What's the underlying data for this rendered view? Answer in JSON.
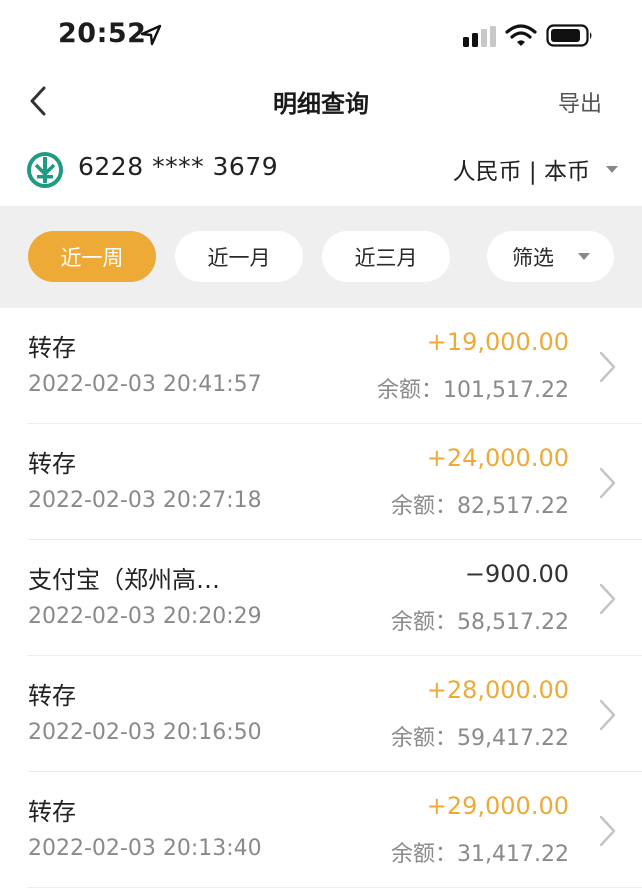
{
  "status_bar": {
    "time": "20:52"
  },
  "nav": {
    "title": "明细查询",
    "export_label": "导出"
  },
  "account": {
    "card_number": "6228 **** 3679",
    "currency": "人民币 | 本币"
  },
  "filters": [
    {
      "label": "近一周",
      "active": true
    },
    {
      "label": "近一月",
      "active": false
    },
    {
      "label": "近三月",
      "active": false
    },
    {
      "label": "筛选",
      "active": false
    }
  ],
  "transactions": [
    {
      "title": "转存",
      "time": "2022-02-03 20:41:57",
      "amount": "+19,000.00",
      "balance": "余额：101,517.22"
    },
    {
      "title": "转存",
      "time": "2022-02-03 20:27:18",
      "amount": "+24,000.00",
      "balance": "余额：82,517.22"
    },
    {
      "title": "支付宝（郑州高…",
      "time": "2022-02-03 20:20:29",
      "amount": "−900.00",
      "balance": "余额：58,517.22"
    },
    {
      "title": "转存",
      "time": "2022-02-03 20:16:50",
      "amount": "+28,000.00",
      "balance": "余额：59,417.22"
    },
    {
      "title": "转存",
      "time": "2022-02-03 20:13:40",
      "amount": "+29,000.00",
      "balance": "余额：31,417.22"
    }
  ],
  "colors": {
    "accent": "#eeaa37",
    "filter_bg": "#efefef",
    "logo": "#1f9a84"
  }
}
